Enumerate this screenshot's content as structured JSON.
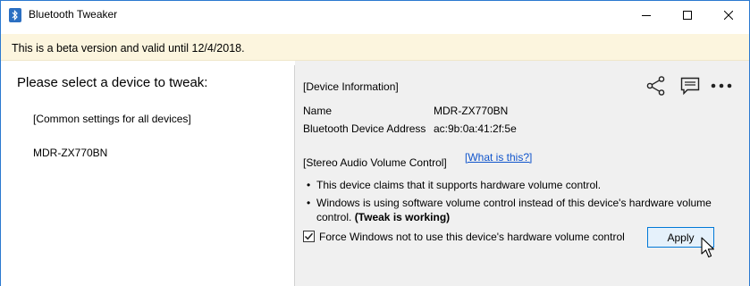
{
  "window": {
    "title": "Bluetooth Tweaker"
  },
  "banner": {
    "text": "This is a beta version and valid until 12/4/2018."
  },
  "left": {
    "heading": "Please select a device to tweak:",
    "devices": [
      "[Common settings for all devices]",
      "MDR-ZX770BN"
    ]
  },
  "device_info": {
    "section_title": "[Device Information]",
    "name_label": "Name",
    "name_value": "MDR-ZX770BN",
    "address_label": "Bluetooth Device Address",
    "address_value": "ac:9b:0a:41:2f:5e"
  },
  "volume": {
    "section_title": "[Stereo Audio Volume Control]",
    "help_link": "[What is this?]",
    "bullet1": "This device claims that it supports hardware volume control.",
    "bullet2_line1": "Windows is using software volume control instead of this device's hardware volume",
    "bullet2_line2_prefix": "control. ",
    "bullet2_line2_bold": "(Tweak is working)",
    "checkbox_label": "Force Windows not to use this device's hardware volume control",
    "checkbox_checked": true,
    "apply_label": "Apply"
  },
  "icons": {
    "share": "share-icon",
    "feedback": "feedback-icon",
    "more": "more-options-icon"
  },
  "colors": {
    "banner_bg": "#fcf5de",
    "right_pane_bg": "#f0f0f0",
    "link": "#1155cc",
    "accent": "#0078d7"
  }
}
